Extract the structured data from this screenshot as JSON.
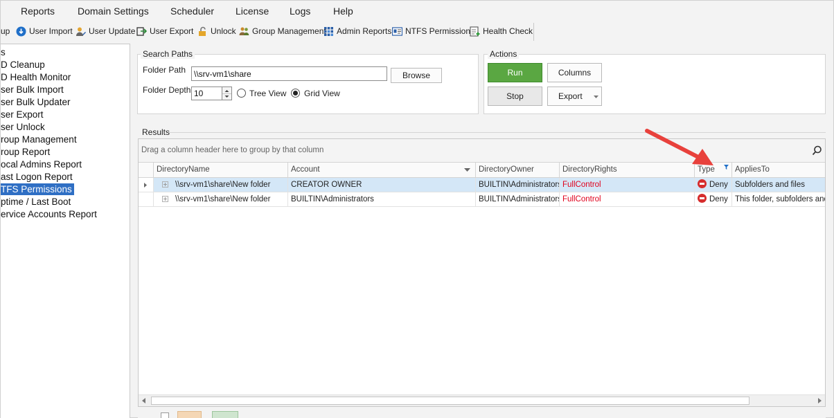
{
  "menu": [
    "Reports",
    "Domain Settings",
    "Scheduler",
    "License",
    "Logs",
    "Help"
  ],
  "toolbar": {
    "partial_label": "up",
    "items": [
      "User Import",
      "User Update",
      "User Export",
      "Unlock",
      "Group Management",
      "Admin Reports",
      "NTFS Permissions",
      "Health Check"
    ]
  },
  "sidebar": {
    "items": [
      "s",
      "D Cleanup",
      "D Health Monitor",
      "ser Bulk Import",
      "ser Bulk Updater",
      "ser Export",
      "ser Unlock",
      "roup Management",
      "roup Report",
      "ocal Admins Report",
      "ast Logon Report",
      "TFS Permissions",
      "ptime / Last Boot",
      "ervice Accounts Report"
    ],
    "selected_index": 11
  },
  "search_paths": {
    "title": "Search Paths",
    "folder_path_label": "Folder Path",
    "folder_path_value": "\\\\srv-vm1\\share",
    "browse_label": "Browse",
    "folder_depth_label": "Folder Depth",
    "folder_depth_value": "10",
    "tree_view_label": "Tree View",
    "grid_view_label": "Grid View",
    "selected_view": "Grid View"
  },
  "actions": {
    "title": "Actions",
    "run_label": "Run",
    "columns_label": "Columns",
    "stop_label": "Stop",
    "export_label": "Export"
  },
  "results": {
    "title": "Results",
    "group_hint": "Drag a column header here to group by that column",
    "columns": [
      "DirectoryName",
      "Account",
      "DirectoryOwner",
      "DirectoryRights",
      "Type",
      "AppliesTo"
    ],
    "rows": [
      {
        "directory": "\\\\srv-vm1\\share\\New folder",
        "account": "CREATOR OWNER",
        "owner": "BUILTIN\\Administrators",
        "rights": "FullControl",
        "type": "Deny",
        "applies": "Subfolders and files"
      },
      {
        "directory": "\\\\srv-vm1\\share\\New folder",
        "account": "BUILTIN\\Administrators",
        "owner": "BUILTIN\\Administrators",
        "rights": "FullControl",
        "type": "Deny",
        "applies": "This folder, subfolders and"
      }
    ]
  },
  "colors": {
    "accent_green": "#5aa742",
    "selection_blue": "#2f6fc4",
    "deny_red": "#d62d2d",
    "rights_red": "#e0001b",
    "arrow_red": "#e8413c"
  }
}
